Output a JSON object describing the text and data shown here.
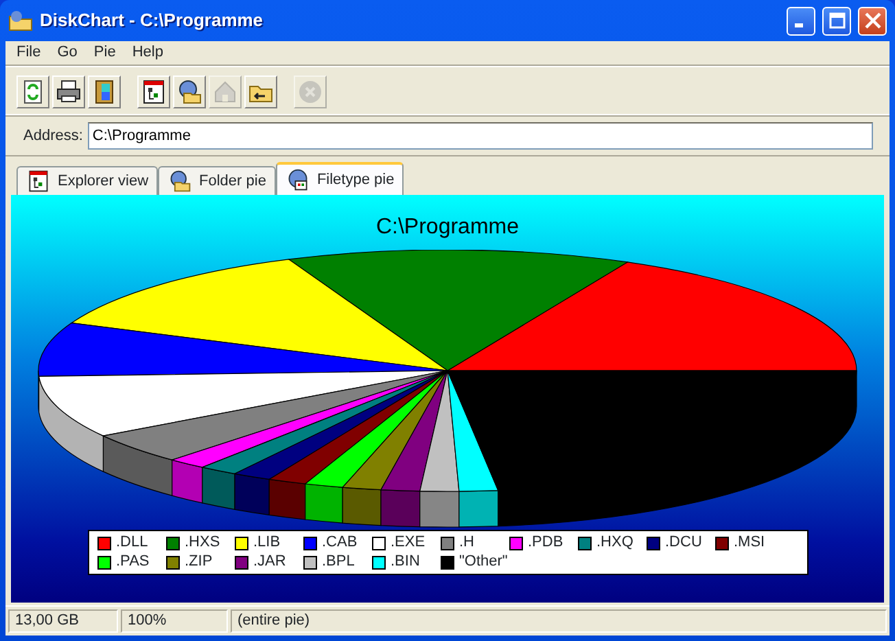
{
  "window": {
    "title": "DiskChart - C:\\Programme"
  },
  "menu": [
    "File",
    "Go",
    "Pie",
    "Help"
  ],
  "toolbar": [
    [
      {
        "disabled": false
      },
      {
        "disabled": false
      },
      {
        "disabled": false
      }
    ],
    [
      {
        "disabled": false
      },
      {
        "disabled": false
      },
      {
        "disabled": true
      },
      {
        "disabled": false
      }
    ],
    [
      {
        "disabled": true
      }
    ]
  ],
  "address": {
    "label": "Address:",
    "value": "C:\\Programme"
  },
  "tabs": [
    {
      "label": "Explorer view",
      "selected": false
    },
    {
      "label": "Folder pie",
      "selected": false
    },
    {
      "label": "Filetype pie",
      "selected": true
    }
  ],
  "pie": {
    "title": "C:\\Programme",
    "legend": [
      {
        "label": ".DLL",
        "color": "#ff0000"
      },
      {
        "label": ".HXS",
        "color": "#008000"
      },
      {
        "label": ".LIB",
        "color": "#ffff00"
      },
      {
        "label": ".CAB",
        "color": "#0000ff"
      },
      {
        "label": ".EXE",
        "color": "#ffffff"
      },
      {
        "label": ".H",
        "color": "#808080"
      },
      {
        "label": ".PDB",
        "color": "#ff00ff"
      },
      {
        "label": ".HXQ",
        "color": "#008080"
      },
      {
        "label": ".DCU",
        "color": "#000080"
      },
      {
        "label": ".MSI",
        "color": "#800000"
      },
      {
        "label": ".PAS",
        "color": "#00ff00"
      },
      {
        "label": ".ZIP",
        "color": "#808000"
      },
      {
        "label": ".JAR",
        "color": "#800080"
      },
      {
        "label": ".BPL",
        "color": "#c0c0c0"
      },
      {
        "label": ".BIN",
        "color": "#00ffff"
      },
      {
        "label": "\"Other\"",
        "color": "#000000"
      }
    ]
  },
  "status_bar": [
    "13,00 GB",
    "100%",
    "(entire pie)"
  ]
}
